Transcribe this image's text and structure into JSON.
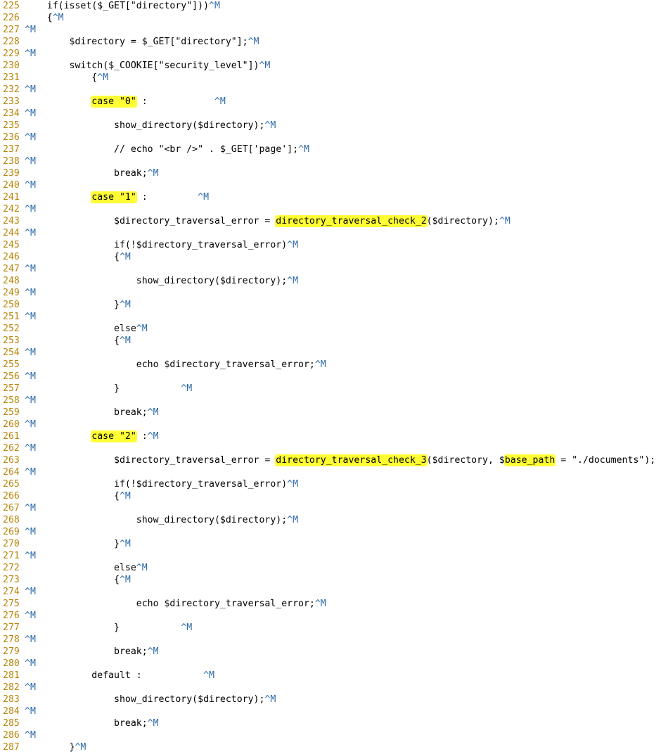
{
  "editor": {
    "cr_marker": "^M",
    "lines": [
      {
        "num": "225",
        "segments": [
          {
            "t": "    if(isset($_GET[\"directory\"]))"
          },
          {
            "t": "^M",
            "cr": true
          }
        ]
      },
      {
        "num": "226",
        "segments": [
          {
            "t": "    {"
          },
          {
            "t": "^M",
            "cr": true
          }
        ]
      },
      {
        "num": "227",
        "segments": [
          {
            "t": "^M",
            "cr": true
          }
        ]
      },
      {
        "num": "228",
        "segments": [
          {
            "t": "        $directory = $_GET[\"directory\"];"
          },
          {
            "t": "^M",
            "cr": true
          }
        ]
      },
      {
        "num": "229",
        "segments": [
          {
            "t": "^M",
            "cr": true
          }
        ]
      },
      {
        "num": "230",
        "segments": [
          {
            "t": "        switch($_COOKIE[\"security_level\"])"
          },
          {
            "t": "^M",
            "cr": true
          }
        ]
      },
      {
        "num": "231",
        "segments": [
          {
            "t": "            {"
          },
          {
            "t": "^M",
            "cr": true
          }
        ]
      },
      {
        "num": "232",
        "segments": [
          {
            "t": "^M",
            "cr": true
          }
        ]
      },
      {
        "num": "233",
        "segments": [
          {
            "t": "            "
          },
          {
            "t": "case \"0\"",
            "hl": true
          },
          {
            "t": " :            "
          },
          {
            "t": "^M",
            "cr": true
          }
        ]
      },
      {
        "num": "234",
        "segments": [
          {
            "t": "^M",
            "cr": true
          }
        ]
      },
      {
        "num": "235",
        "segments": [
          {
            "t": "                show_directory($directory);"
          },
          {
            "t": "^M",
            "cr": true
          }
        ]
      },
      {
        "num": "236",
        "segments": [
          {
            "t": "^M",
            "cr": true
          }
        ]
      },
      {
        "num": "237",
        "segments": [
          {
            "t": "                // echo \"<br />\" . $_GET['page'];"
          },
          {
            "t": "^M",
            "cr": true
          }
        ]
      },
      {
        "num": "238",
        "segments": [
          {
            "t": "^M",
            "cr": true
          }
        ]
      },
      {
        "num": "239",
        "segments": [
          {
            "t": "                break;"
          },
          {
            "t": "^M",
            "cr": true
          }
        ]
      },
      {
        "num": "240",
        "segments": [
          {
            "t": "^M",
            "cr": true
          }
        ]
      },
      {
        "num": "241",
        "segments": [
          {
            "t": "            "
          },
          {
            "t": "case \"1\"",
            "hl": true
          },
          {
            "t": " :         "
          },
          {
            "t": "^M",
            "cr": true
          }
        ]
      },
      {
        "num": "242",
        "segments": [
          {
            "t": "^M",
            "cr": true
          }
        ]
      },
      {
        "num": "243",
        "segments": [
          {
            "t": "                $directory_traversal_error = "
          },
          {
            "t": "directory_traversal_check_2",
            "hl": true
          },
          {
            "t": "($directory);"
          },
          {
            "t": "^M",
            "cr": true
          }
        ]
      },
      {
        "num": "244",
        "segments": [
          {
            "t": "^M",
            "cr": true
          }
        ]
      },
      {
        "num": "245",
        "segments": [
          {
            "t": "                if(!$directory_traversal_error)"
          },
          {
            "t": "^M",
            "cr": true
          }
        ]
      },
      {
        "num": "246",
        "segments": [
          {
            "t": "                {"
          },
          {
            "t": "^M",
            "cr": true
          }
        ]
      },
      {
        "num": "247",
        "segments": [
          {
            "t": "^M",
            "cr": true
          }
        ]
      },
      {
        "num": "248",
        "segments": [
          {
            "t": "                    show_directory($directory);"
          },
          {
            "t": "^M",
            "cr": true
          }
        ]
      },
      {
        "num": "249",
        "segments": [
          {
            "t": "^M",
            "cr": true
          }
        ]
      },
      {
        "num": "250",
        "segments": [
          {
            "t": "                }"
          },
          {
            "t": "^M",
            "cr": true
          }
        ]
      },
      {
        "num": "251",
        "segments": [
          {
            "t": "^M",
            "cr": true
          }
        ]
      },
      {
        "num": "252",
        "segments": [
          {
            "t": "                else"
          },
          {
            "t": "^M",
            "cr": true
          }
        ]
      },
      {
        "num": "253",
        "segments": [
          {
            "t": "                {"
          },
          {
            "t": "^M",
            "cr": true
          }
        ]
      },
      {
        "num": "254",
        "segments": [
          {
            "t": "^M",
            "cr": true
          }
        ]
      },
      {
        "num": "255",
        "segments": [
          {
            "t": "                    echo $directory_traversal_error;"
          },
          {
            "t": "^M",
            "cr": true
          }
        ]
      },
      {
        "num": "256",
        "segments": [
          {
            "t": "^M",
            "cr": true
          }
        ]
      },
      {
        "num": "257",
        "segments": [
          {
            "t": "                }           "
          },
          {
            "t": "^M",
            "cr": true
          }
        ]
      },
      {
        "num": "258",
        "segments": [
          {
            "t": "^M",
            "cr": true
          }
        ]
      },
      {
        "num": "259",
        "segments": [
          {
            "t": "                break;"
          },
          {
            "t": "^M",
            "cr": true
          }
        ]
      },
      {
        "num": "260",
        "segments": [
          {
            "t": "^M",
            "cr": true
          }
        ]
      },
      {
        "num": "261",
        "segments": [
          {
            "t": "            "
          },
          {
            "t": "case \"2\"",
            "hl": true
          },
          {
            "t": " :"
          },
          {
            "t": "^M",
            "cr": true
          }
        ]
      },
      {
        "num": "262",
        "segments": [
          {
            "t": "^M",
            "cr": true
          }
        ]
      },
      {
        "num": "263",
        "segments": [
          {
            "t": "                $directory_traversal_error = "
          },
          {
            "t": "directory_traversal_check_3",
            "hl": true
          },
          {
            "t": "($directory, $"
          },
          {
            "t": "base_path",
            "hl": true
          },
          {
            "t": " = \"./documents\");"
          }
        ]
      },
      {
        "num": "264",
        "segments": [
          {
            "t": "^M",
            "cr": true
          }
        ]
      },
      {
        "num": "265",
        "segments": [
          {
            "t": "                if(!$directory_traversal_error)"
          },
          {
            "t": "^M",
            "cr": true
          }
        ]
      },
      {
        "num": "266",
        "segments": [
          {
            "t": "                {"
          },
          {
            "t": "^M",
            "cr": true
          }
        ]
      },
      {
        "num": "267",
        "segments": [
          {
            "t": "^M",
            "cr": true
          }
        ]
      },
      {
        "num": "268",
        "segments": [
          {
            "t": "                    show_directory($directory);"
          },
          {
            "t": "^M",
            "cr": true
          }
        ]
      },
      {
        "num": "269",
        "segments": [
          {
            "t": "^M",
            "cr": true
          }
        ]
      },
      {
        "num": "270",
        "segments": [
          {
            "t": "                }"
          },
          {
            "t": "^M",
            "cr": true
          }
        ]
      },
      {
        "num": "271",
        "segments": [
          {
            "t": "^M",
            "cr": true
          }
        ]
      },
      {
        "num": "272",
        "segments": [
          {
            "t": "                else"
          },
          {
            "t": "^M",
            "cr": true
          }
        ]
      },
      {
        "num": "273",
        "segments": [
          {
            "t": "                {"
          },
          {
            "t": "^M",
            "cr": true
          }
        ]
      },
      {
        "num": "274",
        "segments": [
          {
            "t": "^M",
            "cr": true
          }
        ]
      },
      {
        "num": "275",
        "segments": [
          {
            "t": "                    echo $directory_traversal_error;"
          },
          {
            "t": "^M",
            "cr": true
          }
        ]
      },
      {
        "num": "276",
        "segments": [
          {
            "t": "^M",
            "cr": true
          }
        ]
      },
      {
        "num": "277",
        "segments": [
          {
            "t": "                }           "
          },
          {
            "t": "^M",
            "cr": true
          }
        ]
      },
      {
        "num": "278",
        "segments": [
          {
            "t": "^M",
            "cr": true
          }
        ]
      },
      {
        "num": "279",
        "segments": [
          {
            "t": "                break;"
          },
          {
            "t": "^M",
            "cr": true
          }
        ]
      },
      {
        "num": "280",
        "segments": [
          {
            "t": "^M",
            "cr": true
          }
        ]
      },
      {
        "num": "281",
        "segments": [
          {
            "t": "            default :           "
          },
          {
            "t": "^M",
            "cr": true
          }
        ]
      },
      {
        "num": "282",
        "segments": [
          {
            "t": "^M",
            "cr": true
          }
        ]
      },
      {
        "num": "283",
        "segments": [
          {
            "t": "                show_directory($directory);"
          },
          {
            "t": "^M",
            "cr": true
          }
        ]
      },
      {
        "num": "284",
        "segments": [
          {
            "t": "^M",
            "cr": true
          }
        ]
      },
      {
        "num": "285",
        "segments": [
          {
            "t": "                break;"
          },
          {
            "t": "^M",
            "cr": true
          }
        ]
      },
      {
        "num": "286",
        "segments": [
          {
            "t": "^M",
            "cr": true
          }
        ]
      },
      {
        "num": "287",
        "segments": [
          {
            "t": "        }"
          },
          {
            "t": "^M",
            "cr": true
          }
        ]
      }
    ]
  }
}
